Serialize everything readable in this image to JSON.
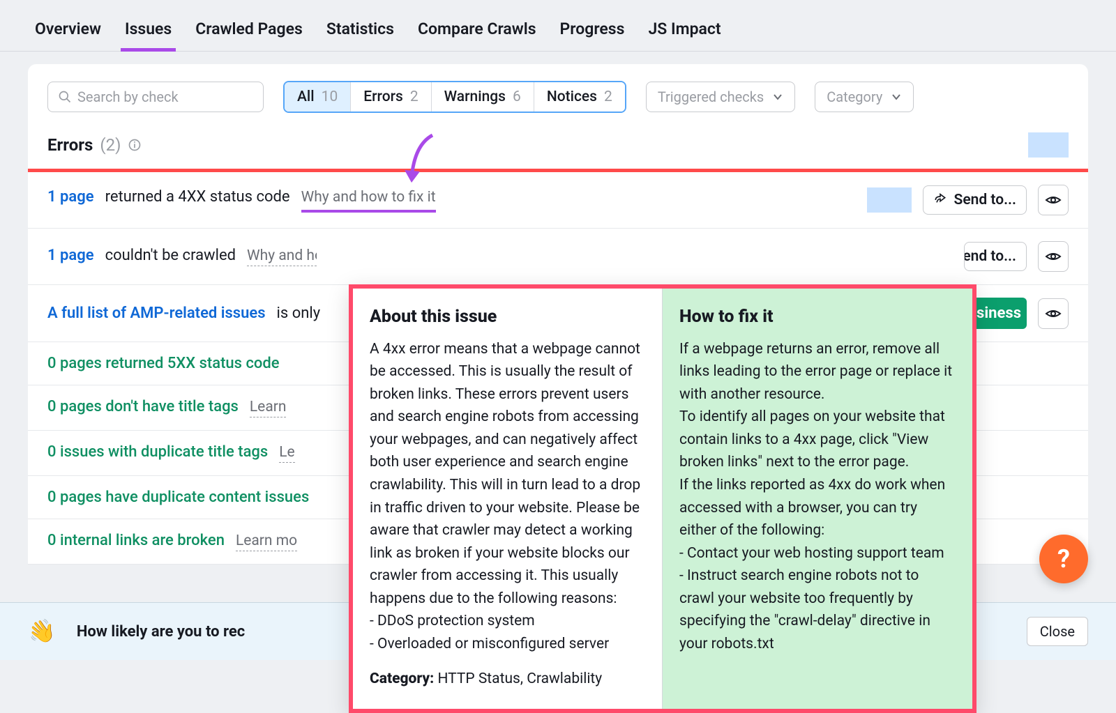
{
  "tabs": [
    "Overview",
    "Issues",
    "Crawled Pages",
    "Statistics",
    "Compare Crawls",
    "Progress",
    "JS Impact"
  ],
  "search_placeholder": "Search by check",
  "filters": [
    {
      "label": "All",
      "count": "10",
      "sel": true
    },
    {
      "label": "Errors",
      "count": "2",
      "sel": false
    },
    {
      "label": "Warnings",
      "count": "6",
      "sel": false
    },
    {
      "label": "Notices",
      "count": "2",
      "sel": false
    }
  ],
  "dropdowns": {
    "triggered": "Triggered checks",
    "category": "Category"
  },
  "section": {
    "title": "Errors",
    "count": "(2)"
  },
  "rows": [
    {
      "link": "1 page",
      "text": "returned a 4XX status code",
      "why": "Why and how to fix it",
      "kind": "blue",
      "why_hl": true,
      "actions": [
        "hl",
        "send",
        "eye"
      ]
    },
    {
      "link": "1 page",
      "text": "couldn't be crawled",
      "why": "Why and how to fix it",
      "kind": "blue",
      "actions": [
        "send",
        "eye"
      ]
    },
    {
      "link": "A full list of AMP-related issues",
      "text": "is only",
      "why": "",
      "kind": "blue",
      "actions": [
        "pill",
        "eye"
      ],
      "pill": "usiness"
    },
    {
      "link": "0 pages returned 5XX status code",
      "text": "",
      "why": "",
      "kind": "green"
    },
    {
      "link": "0 pages don't have title tags",
      "text": "",
      "why": "Learn",
      "kind": "green"
    },
    {
      "link": "0 issues with duplicate title tags",
      "text": "",
      "why": "Le",
      "kind": "green"
    },
    {
      "link": "0 pages have duplicate content issues",
      "text": "",
      "why": "",
      "kind": "green"
    },
    {
      "link": "0 internal links are broken",
      "text": "",
      "why": "Learn mo",
      "kind": "green"
    }
  ],
  "send_label": "Send to...",
  "tooltip": {
    "about_title": "About this issue",
    "about_body": "A 4xx error means that a webpage cannot be accessed. This is usually the result of broken links. These errors prevent users and search engine robots from accessing your webpages, and can negatively affect both user experience and search engine crawlability. This will in turn lead to a drop in traffic driven to your website. Please be aware that crawler may detect a working link as broken if your website blocks our crawler from accessing it. This usually happens due to the following reasons:\n- DDoS protection system\n- Overloaded or misconfigured server",
    "cat_label": "Category:",
    "cat_value": "HTTP Status, Crawlability",
    "fix_title": "How to fix it",
    "fix_body": "If a webpage returns an error, remove all links leading to the error page or replace it with another resource.\nTo identify all pages on your website that contain links to a 4xx page, click \"View broken links\" next to the error page.\nIf the links reported as 4xx do work when accessed with a browser, you can try either of the following:\n- Contact your web hosting support team\n- Instruct search engine robots not to crawl your website too frequently by specifying the \"crawl-delay\" directive in your robots.txt"
  },
  "survey": {
    "text": "How likely are you to rec",
    "close": "Close"
  },
  "help": "?"
}
